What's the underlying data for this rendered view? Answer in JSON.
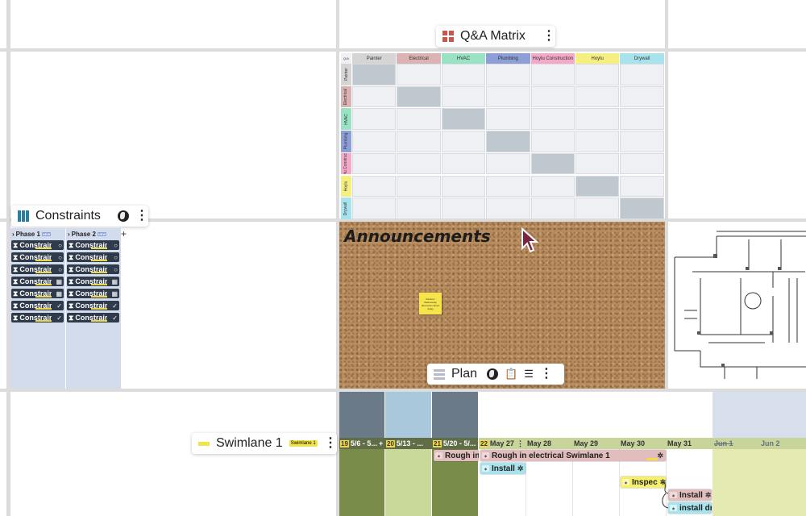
{
  "qa_matrix": {
    "title": "Q&A Matrix",
    "corner": "Q/A",
    "columns": [
      "Painter",
      "Electrical",
      "HVAC",
      "Plumbing",
      "Hoylu Construction",
      "Hoylu",
      "Drywall"
    ],
    "column_colors": [
      "#d5d5d5",
      "#dcb3b3",
      "#99e3c4",
      "#8e9fd8",
      "#f4a9c9",
      "#f5ef82",
      "#a7e3ec"
    ],
    "rows": [
      "Painter",
      "Electrical",
      "HVAC",
      "Plumbing",
      "Hoylu Construction",
      "Hoylu",
      "Drywall"
    ]
  },
  "constraints": {
    "title": "Constraints",
    "phases": [
      {
        "label": "Phase 1",
        "badge": "NEW"
      },
      {
        "label": "Phase 2",
        "badge": "NEW"
      }
    ],
    "card_label": "Constraint",
    "statuses_phase1": [
      "○",
      "○",
      "○",
      "▦",
      "▦",
      "✓",
      "✓"
    ],
    "statuses_phase2": [
      "○",
      "○",
      "○",
      "▦",
      "▦",
      "✓",
      "✓"
    ],
    "add_symbol": "+"
  },
  "announcements": {
    "title": "Announcements",
    "sticky_text": "Painters Wednesday discussion about delay"
  },
  "plan": {
    "title": "Plan"
  },
  "swimlane": {
    "title": "Swimlane 1",
    "badge": "Swimlane 1",
    "weeks": [
      {
        "num": "19",
        "label": "5/6 - 5...",
        "add": "+"
      },
      {
        "num": "20",
        "label": "5/13 - ..."
      },
      {
        "num": "21",
        "label": "5/20 - 5/..."
      },
      {
        "num": "22",
        "label": "May 27"
      }
    ],
    "days": [
      "May 28",
      "May 29",
      "May 30",
      "May 31",
      "Jun 1",
      "Jun 2"
    ],
    "tasks": {
      "rough_in_short": "Rough in",
      "rough_in_long": "Rough in electrical Swimlane 1",
      "install_1": "Install",
      "inspect": "Inspec",
      "install_2": "Install",
      "install_3": "install dr"
    }
  },
  "colors": {
    "grid_line": "#dcdcdc",
    "week_gray": "#6b7a88",
    "week_blue": "#a9c8dc",
    "lane_olive": "#7a8c4a",
    "lane_light": "#c8d99a",
    "lane_yellow": "#e4eab2",
    "jun_blue": "#d7deec"
  }
}
